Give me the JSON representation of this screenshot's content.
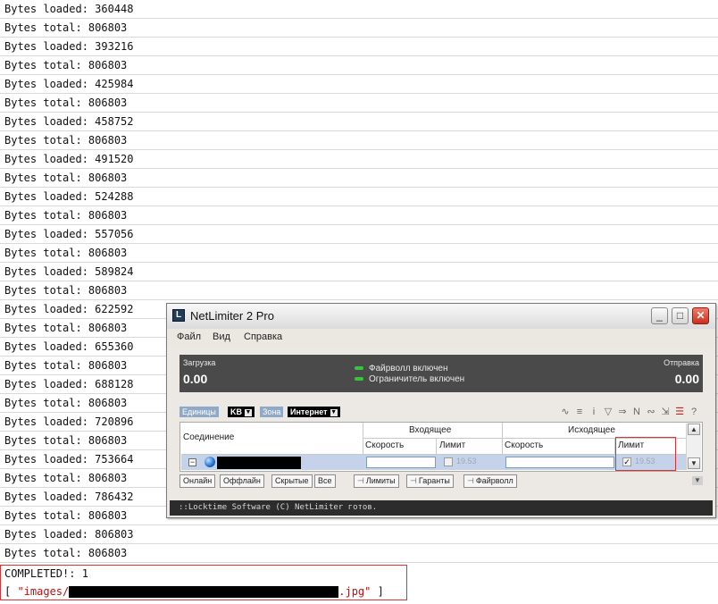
{
  "console": {
    "lines": [
      "Bytes loaded: 360448",
      "Bytes total: 806803",
      "Bytes loaded: 393216",
      "Bytes total: 806803",
      "Bytes loaded: 425984",
      "Bytes total: 806803",
      "Bytes loaded: 458752",
      "Bytes total: 806803",
      "Bytes loaded: 491520",
      "Bytes total: 806803",
      "Bytes loaded: 524288",
      "Bytes total: 806803",
      "Bytes loaded: 557056",
      "Bytes total: 806803",
      "Bytes loaded: 589824",
      "Bytes total: 806803",
      "Bytes loaded: 622592",
      "Bytes total: 806803",
      "Bytes loaded: 655360",
      "Bytes total: 806803",
      "Bytes loaded: 688128",
      "Bytes total: 806803",
      "Bytes loaded: 720896",
      "Bytes total: 806803",
      "Bytes loaded: 753664",
      "Bytes total: 806803",
      "Bytes loaded: 786432",
      "Bytes total: 806803",
      "Bytes loaded: 806803",
      "Bytes total: 806803"
    ],
    "completed_line": "COMPLETED!: 1",
    "result_open": "[ ",
    "result_prefix": "\"images/",
    "result_suffix": ".jpg\"",
    "result_close": " ]"
  },
  "netlimiter": {
    "title": "NetLimiter 2 Pro",
    "logo_glyph": "L",
    "window_buttons": {
      "minimize": "_",
      "maximize": "□",
      "close": "✕"
    },
    "menu": [
      "Файл",
      "Вид",
      "Справка"
    ],
    "stats": {
      "download_label": "Загрузка",
      "download_value": "0.00",
      "upload_label": "Отправка",
      "upload_value": "0.00",
      "firewall_status": "Файрволл включен",
      "limiter_status": "Ограничитель включен",
      "led_color": "#39c43f"
    },
    "filters": {
      "units_label": "Единицы",
      "units_value": "KB",
      "zone_label": "Зона",
      "zone_value": "Интернет"
    },
    "toolbar_icons": [
      "wave-icon",
      "sort-icon",
      "info-icon",
      "filter-icon",
      "arrows-icon",
      "node-icon",
      "link-icon",
      "export-icon",
      "delete-list-icon",
      "help-icon"
    ],
    "grid": {
      "col_connection": "Соединение",
      "group_incoming": "Входящее",
      "group_outgoing": "Исходящее",
      "col_speed_in": "Скорость",
      "col_limit_in": "Лимит",
      "col_speed_out": "Скорость",
      "col_limit_out": "Лимит",
      "row": {
        "expand": "−",
        "limit_in": "19.53",
        "limit_in_checked": false,
        "limit_out": "19.53",
        "limit_out_checked": true
      }
    },
    "tabs": [
      "Онлайн",
      "Оффлайн",
      "Скрытые",
      "Все"
    ],
    "rule_tabs": [
      "Лимиты",
      "Гаранты",
      "Файрволл"
    ],
    "status_text": "::Locktime Software (C) NetLimiter готов."
  }
}
